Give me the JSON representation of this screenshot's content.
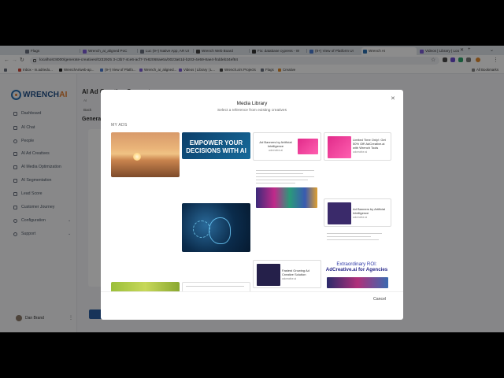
{
  "browser": {
    "tabs": [
      {
        "label": "Flags",
        "active": false
      },
      {
        "label": "Wrench_ai_aligned PoC",
        "active": false
      },
      {
        "label": "Luc (9+) Native App, AR UI",
        "active": false
      },
      {
        "label": "Wrench Web Board",
        "active": false
      },
      {
        "label": "Fix: database cypress - W",
        "active": false
      },
      {
        "label": "(9+) View of Platform UI",
        "active": false
      },
      {
        "label": "Wrench AI",
        "active": true
      },
      {
        "label": "Videos | Library | Loo",
        "active": false
      }
    ],
    "url": "localhost:8000/generate-creatives/0232925 3-c3b7-4ce6-acf7-7e82068ae6a/0023a61d-b203-4e59-8ae4-f4ddeb34ef84",
    "bookmarks": [
      "Inbox - m.adriedo...",
      "WrenchAI/web-ap...",
      "(9+) View of Platfo...",
      "Wrench_ai_aligned...",
      "Videos | Library | L...",
      "Wrench.ai's Projects",
      "Flags",
      "Creative"
    ],
    "all_bookmarks": "All Bookmarks"
  },
  "app": {
    "logo": "WRENCH",
    "logo_suffix": "AI",
    "nav": [
      "Dashboard",
      "AI Chat",
      "People",
      "AI Ad Creatives",
      "AI Media Optimization",
      "AI Segmentation",
      "Lead Score",
      "Customer Journey",
      "Configuration",
      "Support"
    ],
    "user_name": "Dan Brand",
    "page_title": "AI Ad Creative Generator",
    "breadcrumb": "AI",
    "back": "Back",
    "sub_title": "Genera"
  },
  "modal": {
    "title": "Media Library",
    "subtitle": "Select a reference from existing creatives",
    "section": "MY ADS",
    "cancel": "Cancel",
    "ads": {
      "empower": "EMPOWER YOUR DECISIONS WITH AI",
      "banners1_title": "Ad Banners by Artificial Intelligence",
      "banners1_sub": "adcreative.ai",
      "limited_title": "Limited Time Only!: Get 50% Off! AdCreative.ai with Wrench Tools",
      "limited_sub": "adcreative.ai",
      "banners2_title": "Ad Banners by Artificial Intelligence",
      "banners2_sub": "adcreative.ai",
      "fastest_title": "Fastest Growing Ad Creative Solution",
      "fastest_sub": "adcreative.ai",
      "extra_line1": "Extraordinary ROI:",
      "extra_line2": "AdCreative.ai for Agencies"
    }
  }
}
